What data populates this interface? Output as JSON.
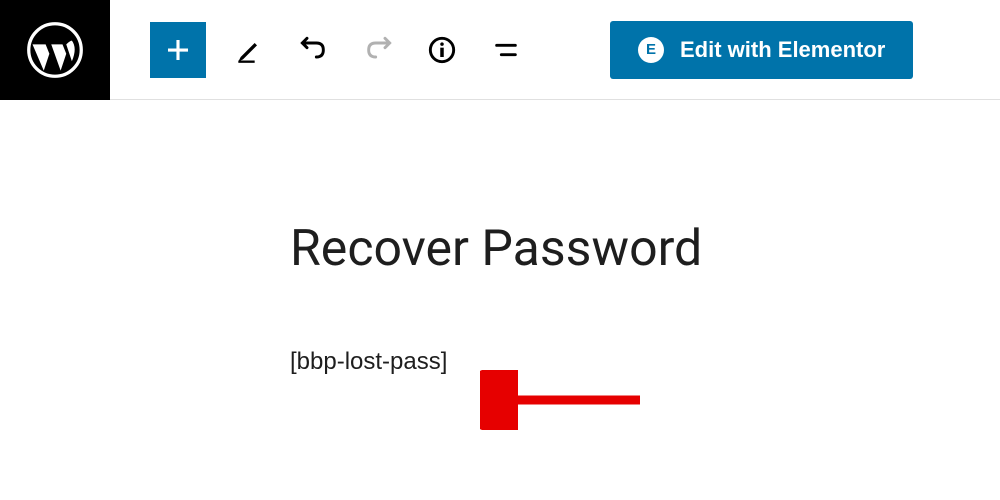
{
  "toolbar": {
    "elementor_label": "Edit with Elementor"
  },
  "post": {
    "title": "Recover Password",
    "body": "[bbp-lost-pass]"
  },
  "icons": {
    "plus": "plus",
    "edit": "edit",
    "undo": "undo",
    "redo": "redo",
    "info": "info",
    "list": "list"
  }
}
